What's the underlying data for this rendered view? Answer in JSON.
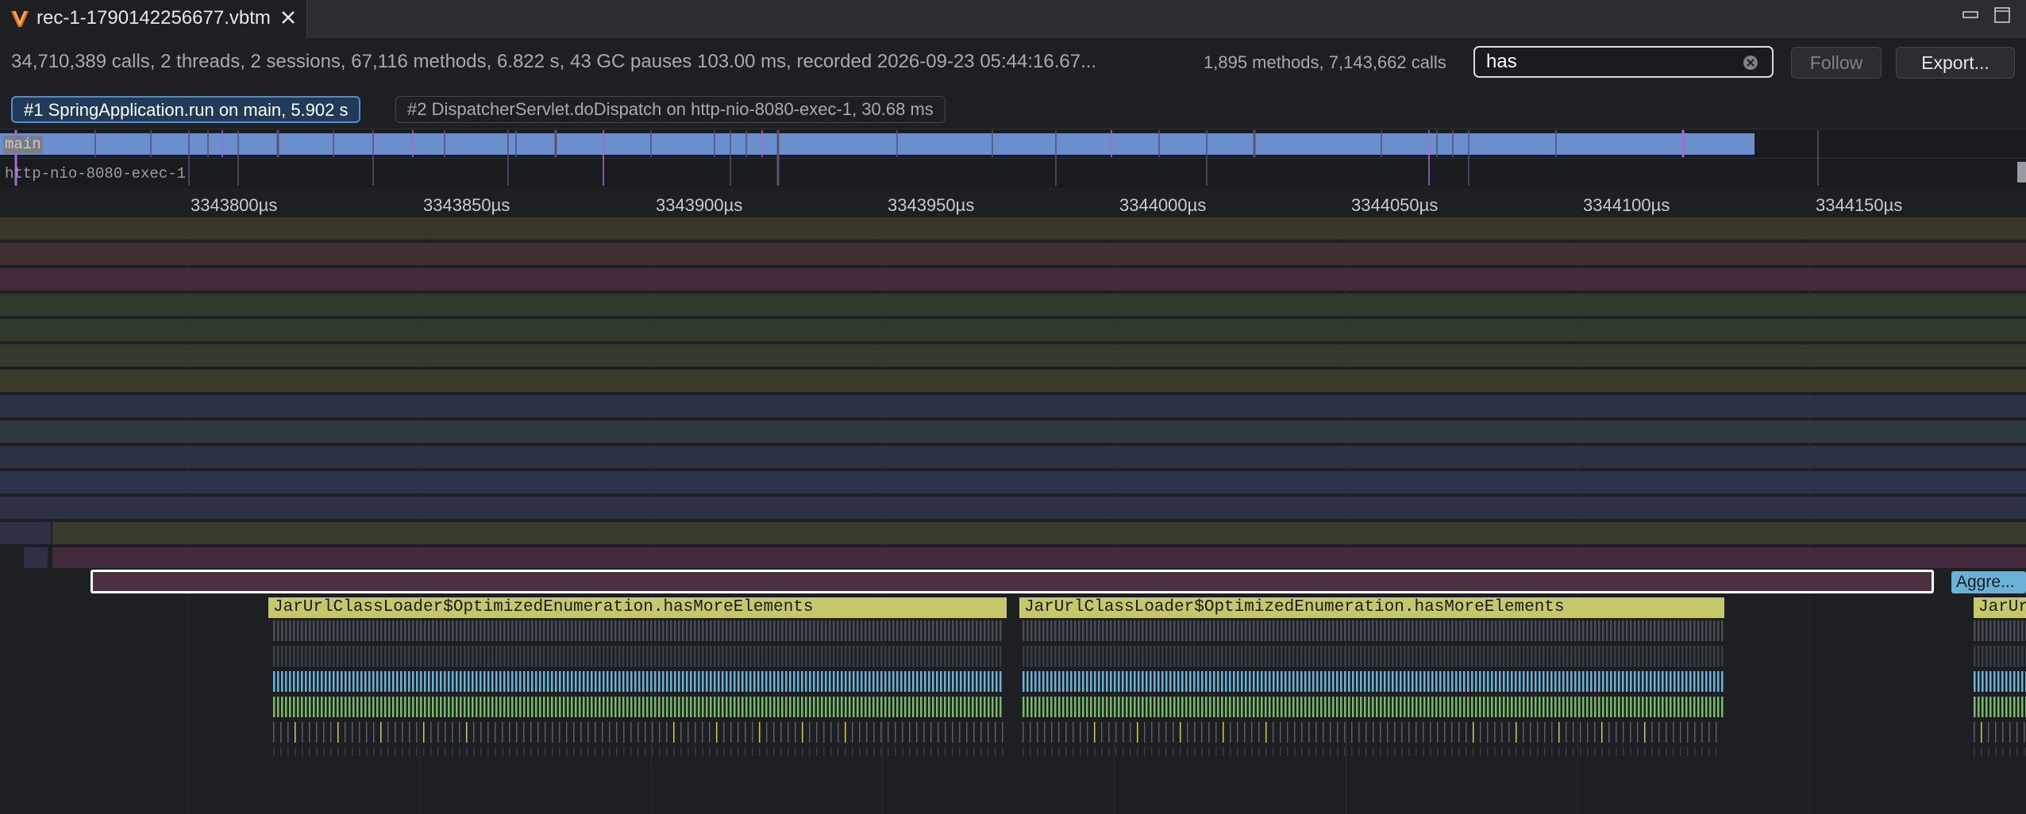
{
  "tab": {
    "title": "rec-1-1790142256677.vbtm"
  },
  "info": {
    "summary": "34,710,389 calls, 2 threads, 2 sessions, 67,116 methods, 6.822 s, 43 GC pauses 103.00 ms, recorded 2026-09-23 05:44:16.67...",
    "counts": "1,895 methods, 7,143,662 calls"
  },
  "search": {
    "value": "has"
  },
  "buttons": {
    "follow": "Follow",
    "export": "Export..."
  },
  "roots": [
    {
      "label": "#1 SpringApplication.run on main, 5.902 s"
    },
    {
      "label": "#2 DispatcherServlet.doDispatch on http-nio-8080-exec-1, 30.68 ms"
    }
  ],
  "threads": {
    "main": "main",
    "exec": "http-nio-8080-exec-1"
  },
  "ruler": {
    "ticks": [
      "3343800µs",
      "3343850µs",
      "3343900µs",
      "3343950µs",
      "3344000µs",
      "3344050µs",
      "3344100µs",
      "3344150µs"
    ]
  },
  "frames": {
    "hit1": "JarUrlClassLoader$OptimizedEnumeration.hasMoreElements",
    "hit2": "JarUrlClassLoader$OptimizedEnumeration.hasMoreElements",
    "hit3": "JarUrlClassLoader$OptimizedEnumeration.hasMoreElements",
    "aggre": "Aggre..."
  },
  "colors": {
    "background": "#1e1f22",
    "highlight": "#c6c66a",
    "main_thread": "#6a8fcc",
    "selected_border": "#ffffff",
    "accent_cyan": "#6ab2d6",
    "accent_green": "#7ab86a"
  },
  "icons": {
    "logo": "app-logo-icon",
    "close": "close-icon",
    "clear": "clear-search-icon",
    "minimize": "minimize-icon",
    "maximize": "maximize-icon"
  }
}
